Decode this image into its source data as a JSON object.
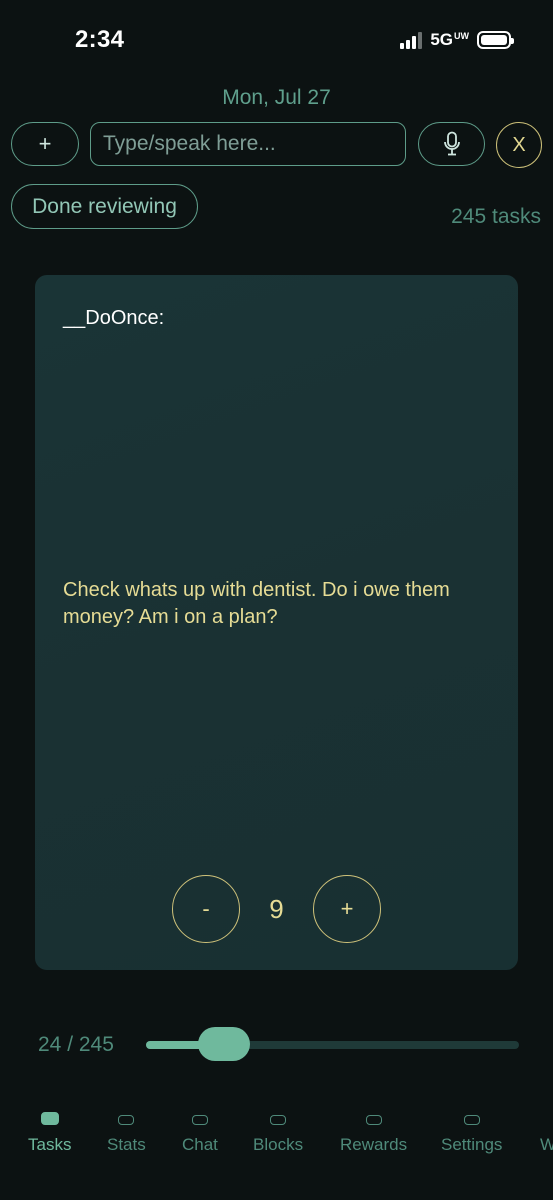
{
  "status_bar": {
    "time": "2:34",
    "network": "5G",
    "network_sup": "UW"
  },
  "header": {
    "date": "Mon, Jul 27"
  },
  "toolbar": {
    "add_label": "+",
    "input_placeholder": "Type/speak here...",
    "mic_icon": "microphone-icon",
    "close_label": "X"
  },
  "review": {
    "done_label": "Done reviewing",
    "task_count": "245 tasks"
  },
  "card": {
    "label": "__DoOnce:",
    "text": "Check whats up with dentist. Do i owe them money? Am i on a plan?",
    "minus_label": "-",
    "value": "9",
    "plus_label": "+"
  },
  "progress": {
    "text": "24 / 245",
    "current": 24,
    "total": 245
  },
  "tabs": [
    {
      "label": "Tasks",
      "active": true
    },
    {
      "label": "Stats",
      "active": false
    },
    {
      "label": "Chat",
      "active": false
    },
    {
      "label": "Blocks",
      "active": false
    },
    {
      "label": "Rewards",
      "active": false
    },
    {
      "label": "Settings",
      "active": false
    },
    {
      "label": "W",
      "active": false
    }
  ],
  "colors": {
    "accent": "#6fb99d",
    "text_yellow": "#e6dc95",
    "muted_green": "#4f8a7a",
    "background": "#0c1212"
  }
}
